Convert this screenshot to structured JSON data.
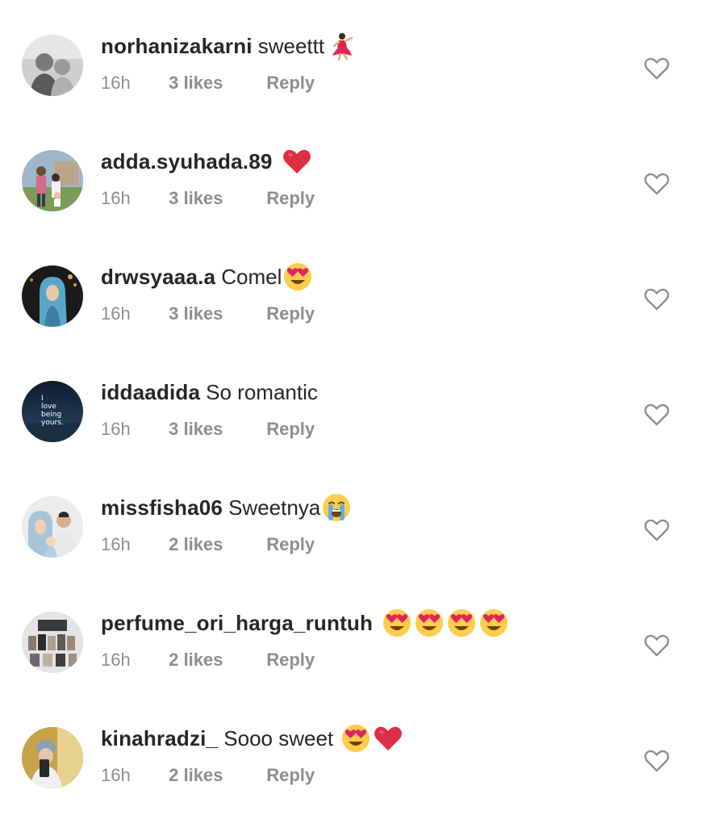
{
  "comments": [
    {
      "username": "norhanizakarni",
      "text": "sweettt",
      "emojis": [
        "dancer-emoji"
      ],
      "time": "16h",
      "likes": "3 likes",
      "reply": "Reply"
    },
    {
      "username": "adda.syuhada.89",
      "text": "",
      "emojis": [
        "red-heart-emoji"
      ],
      "time": "16h",
      "likes": "3 likes",
      "reply": "Reply"
    },
    {
      "username": "drwsyaaa.a",
      "text": "Comel",
      "emojis": [
        "heart-eyes-emoji"
      ],
      "time": "16h",
      "likes": "3 likes",
      "reply": "Reply"
    },
    {
      "username": "iddaadida",
      "text": "So romantic",
      "emojis": [],
      "time": "16h",
      "likes": "3 likes",
      "reply": "Reply",
      "avatar_text": [
        "I",
        "love",
        "being",
        "yours."
      ]
    },
    {
      "username": "missfisha06",
      "text": "Sweetnya",
      "emojis": [
        "loudly-crying-emoji"
      ],
      "time": "16h",
      "likes": "2 likes",
      "reply": "Reply"
    },
    {
      "username": "perfume_ori_harga_runtuh",
      "text": "",
      "emojis": [
        "heart-eyes-emoji",
        "heart-eyes-emoji",
        "heart-eyes-emoji",
        "heart-eyes-emoji"
      ],
      "time": "16h",
      "likes": "2 likes",
      "reply": "Reply"
    },
    {
      "username": "kinahradzi_",
      "text": "Sooo sweet",
      "emojis": [
        "heart-eyes-emoji",
        "red-heart-emoji"
      ],
      "time": "16h",
      "likes": "2 likes",
      "reply": "Reply"
    }
  ],
  "colors": {
    "username": "#262626",
    "meta": "#8e8e8e",
    "heart_outline": "#8e8e8e",
    "emoji_yellow": "#FFC83D",
    "emoji_red": "#E0245E"
  }
}
